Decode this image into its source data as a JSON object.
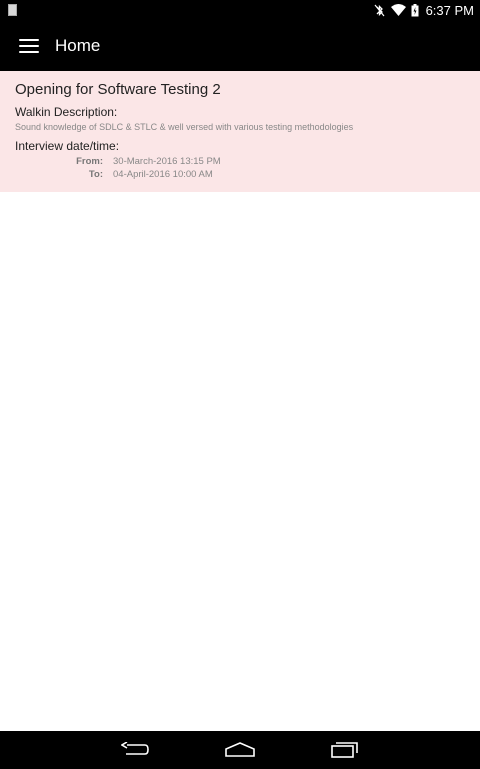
{
  "status_bar": {
    "time": "6:37 PM"
  },
  "app_bar": {
    "title": "Home"
  },
  "card": {
    "title": "Opening for Software Testing 2",
    "description_label": "Walkin Description:",
    "description": "Sound knowledge of SDLC & STLC & well versed with various testing methodologies",
    "interview_label": "Interview date/time:",
    "from_label": "From:",
    "from_value": "30-March-2016 13:15 PM",
    "to_label": "To:",
    "to_value": "04-April-2016 10:00 AM"
  },
  "colors": {
    "card_background": "#fbe6e7",
    "bars": "#000000"
  }
}
